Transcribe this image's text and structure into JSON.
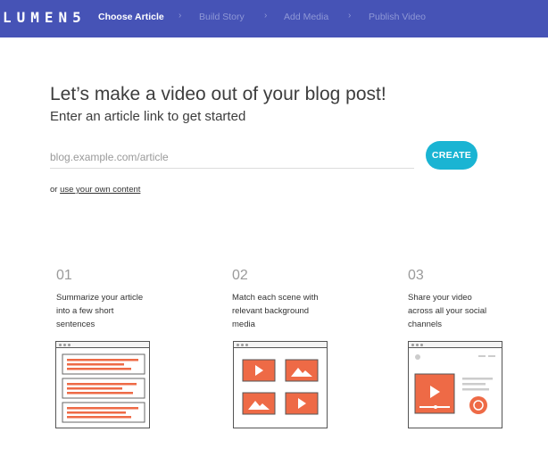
{
  "app": {
    "logo": "LUMEN5"
  },
  "nav": {
    "steps": [
      {
        "label": "Choose Article"
      },
      {
        "label": "Build Story"
      },
      {
        "label": "Add Media"
      },
      {
        "label": "Publish Video"
      }
    ],
    "separator": "›"
  },
  "hero": {
    "headline": "Let’s make a video out of your blog post!",
    "subhead": "Enter an article link to get started",
    "url_placeholder": "blog.example.com/article",
    "create_label": "CREATE",
    "alt_prefix": "or",
    "alt_link": "use your own content"
  },
  "steps": [
    {
      "number": "01",
      "text": "Summarize your article into a few short sentences"
    },
    {
      "number": "02",
      "text": "Match each scene with relevant background media"
    },
    {
      "number": "03",
      "text": "Share your video across all your social channels"
    }
  ],
  "colors": {
    "nav": "#4653b6",
    "accent": "#1ab4d3",
    "illustration": "#ee6a46"
  }
}
